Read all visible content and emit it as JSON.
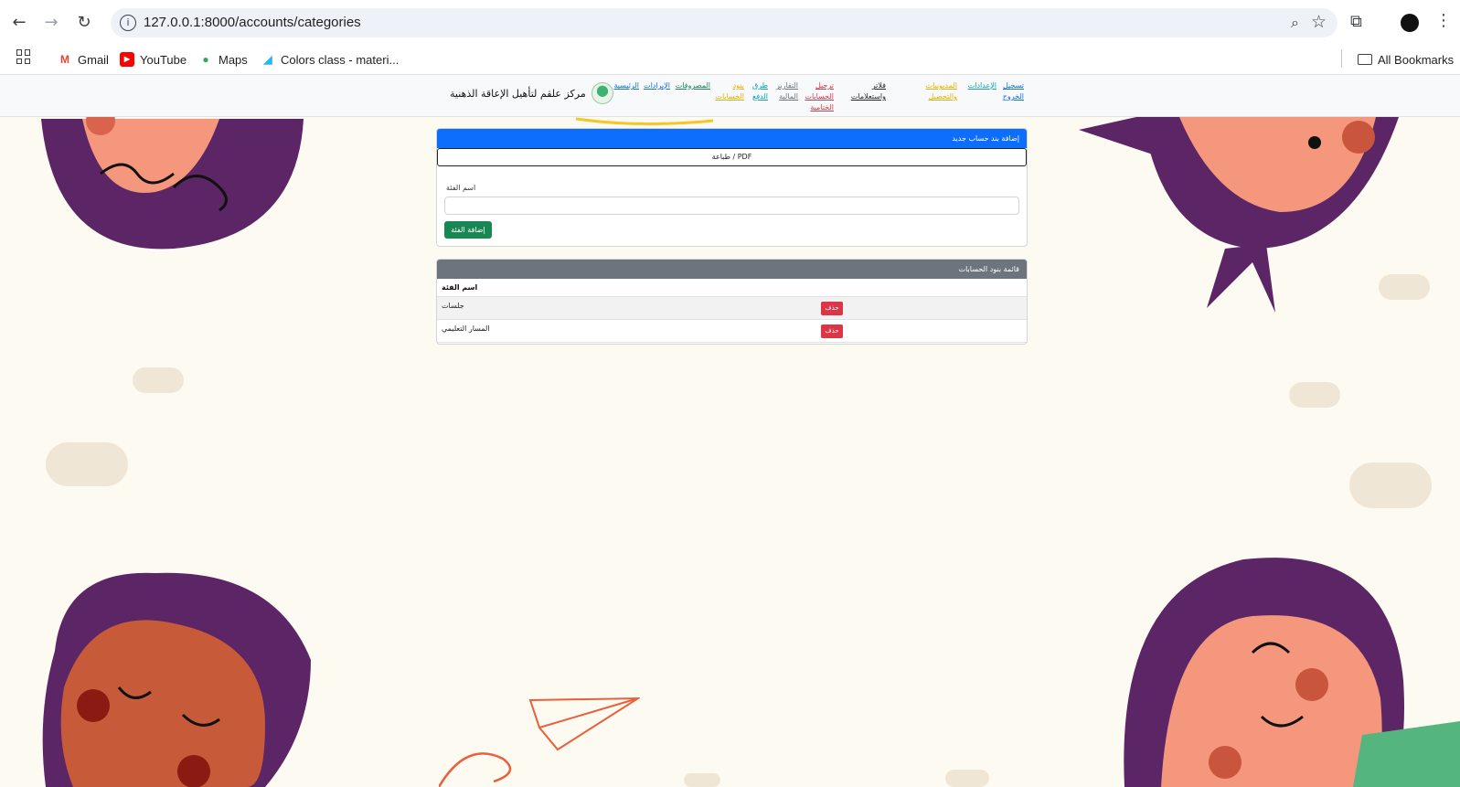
{
  "browser": {
    "url": "127.0.0.1:8000/accounts/categories",
    "bookmarks": [
      "Gmail",
      "YouTube",
      "Maps",
      "Colors class - materi..."
    ],
    "all_bookmarks": "All Bookmarks"
  },
  "site": {
    "brand": "مركز علقم لتأهيل الإعاقة الذهنية",
    "nav": [
      {
        "label": "الرئيسية",
        "color": "#0d6efd"
      },
      {
        "label": "الإيرادات",
        "color": "#0d6efd"
      },
      {
        "label": "المصروفات",
        "color": "#198754"
      },
      {
        "label": "بنود الحسابات",
        "color": "#f0ad00"
      },
      {
        "label": "طرق الدفع",
        "color": "#0aa2c0"
      },
      {
        "label": "التقارير المالية",
        "color": "#6c757d"
      },
      {
        "label": "ترحيل الحسابات الختامية",
        "color": "#dc3545"
      },
      {
        "label": "فلاتر واستعلامات",
        "color": "#212529"
      },
      {
        "label": "المديونيات والتحصيل",
        "color": "#f0ad00"
      },
      {
        "label": "الإعدادات",
        "color": "#0aa2c0"
      },
      {
        "label": "تسجيل الخروج",
        "color": "#0d6efd"
      }
    ]
  },
  "add_card": {
    "header": "إضافة بند حساب جديد",
    "print_label": "طباعة / PDF",
    "field_label": "اسم الفئة",
    "input_value": "",
    "submit_label": "إضافة الفئة"
  },
  "list_card": {
    "header": "قائمة بنود الحسابات",
    "column": "اسم الفئة",
    "rows": [
      {
        "name": "جلسات",
        "action": "حذف"
      },
      {
        "name": "المسار التعليمي",
        "action": "حذف"
      }
    ]
  },
  "colors": {
    "primary_header": "#0d6efd",
    "secondary_header": "#6c757d",
    "success": "#198754",
    "danger": "#dc3545",
    "page_bg": "#fdfaf1",
    "deco_purple": "#5b2566",
    "deco_skin": "#f4977c"
  }
}
